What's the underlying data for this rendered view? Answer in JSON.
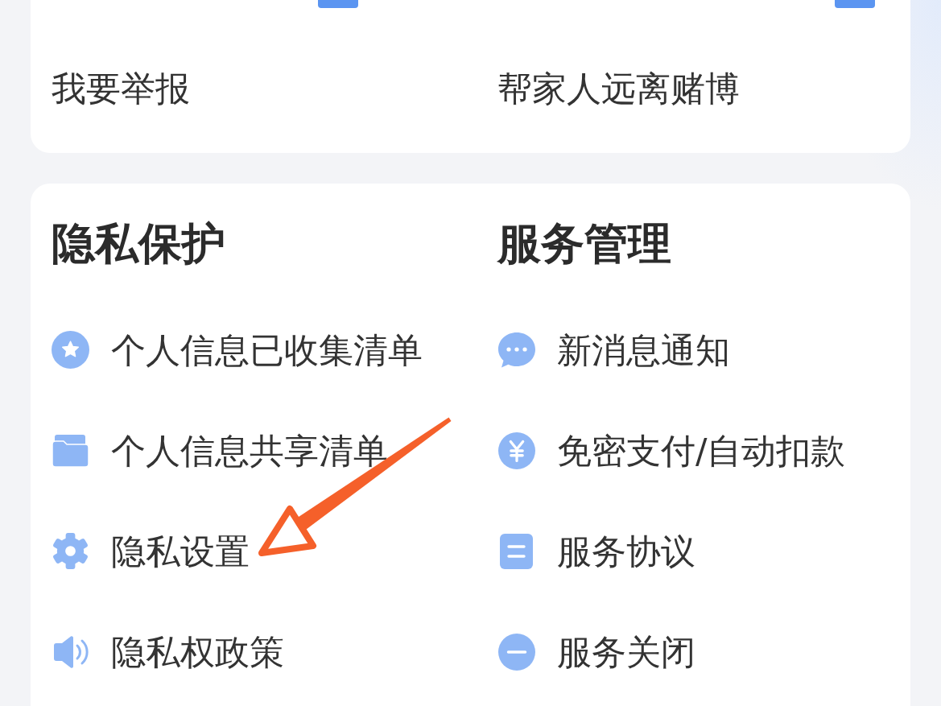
{
  "top_card": {
    "clipped_row": [
      {
        "badge": true
      },
      {
        "badge": true
      }
    ],
    "items": [
      {
        "label": "我要举报"
      },
      {
        "label": "帮家人远离赌博"
      }
    ]
  },
  "sections": [
    {
      "title": "隐私保护",
      "items": [
        {
          "label": "个人信息已收集清单"
        },
        {
          "label": "个人信息共享清单"
        },
        {
          "label": "隐私设置"
        },
        {
          "label": "隐私权政策"
        }
      ]
    },
    {
      "title": "服务管理",
      "items": [
        {
          "label": "新消息通知"
        },
        {
          "label": "免密支付/自动扣款"
        },
        {
          "label": "服务协议"
        },
        {
          "label": "服务关闭"
        }
      ]
    }
  ]
}
